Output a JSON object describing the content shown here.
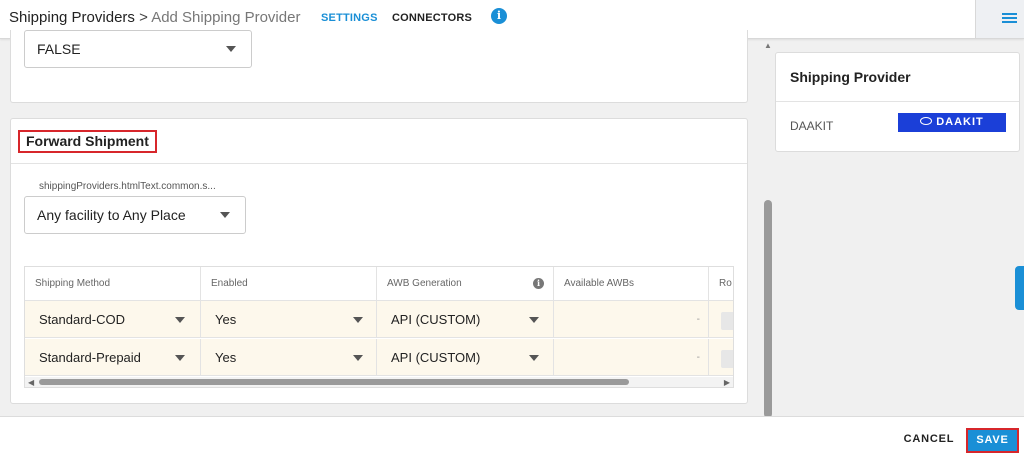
{
  "header": {
    "breadcrumb_parent": "Shipping Providers",
    "breadcrumb_separator": ">",
    "breadcrumb_current": "Add Shipping Provider",
    "tabs": [
      {
        "label": "SETTINGS",
        "active": true
      },
      {
        "label": "CONNECTORS",
        "active": false
      }
    ],
    "info_glyph": "i",
    "icons": [
      "info-icon",
      "hamburger-menu-icon"
    ]
  },
  "top_card": {
    "select_value": "FALSE"
  },
  "forward_shipment": {
    "title": "Forward Shipment",
    "field_label": "shippingProviders.htmlText.common.s...",
    "facility_select": "Any facility to Any Place",
    "table": {
      "columns": [
        "Shipping Method",
        "Enabled",
        "AWB Generation",
        "Available AWBs",
        "Ro"
      ],
      "rows": [
        {
          "method": "Standard-COD",
          "enabled": "Yes",
          "awb_generation": "API (CUSTOM)",
          "available_awbs": "-"
        },
        {
          "method": "Standard-Prepaid",
          "enabled": "Yes",
          "awb_generation": "API (CUSTOM)",
          "available_awbs": "-"
        }
      ]
    }
  },
  "right_panel": {
    "title": "Shipping Provider",
    "provider_name": "DAAKIT",
    "logo_text": "DAAKIT"
  },
  "footer": {
    "cancel_label": "CANCEL",
    "save_label": "SAVE"
  },
  "colors": {
    "accent": "#1a8fd6",
    "highlight_border": "#d7262b",
    "row_background": "#fdf8ec",
    "logo_background": "#1b3fd8"
  }
}
